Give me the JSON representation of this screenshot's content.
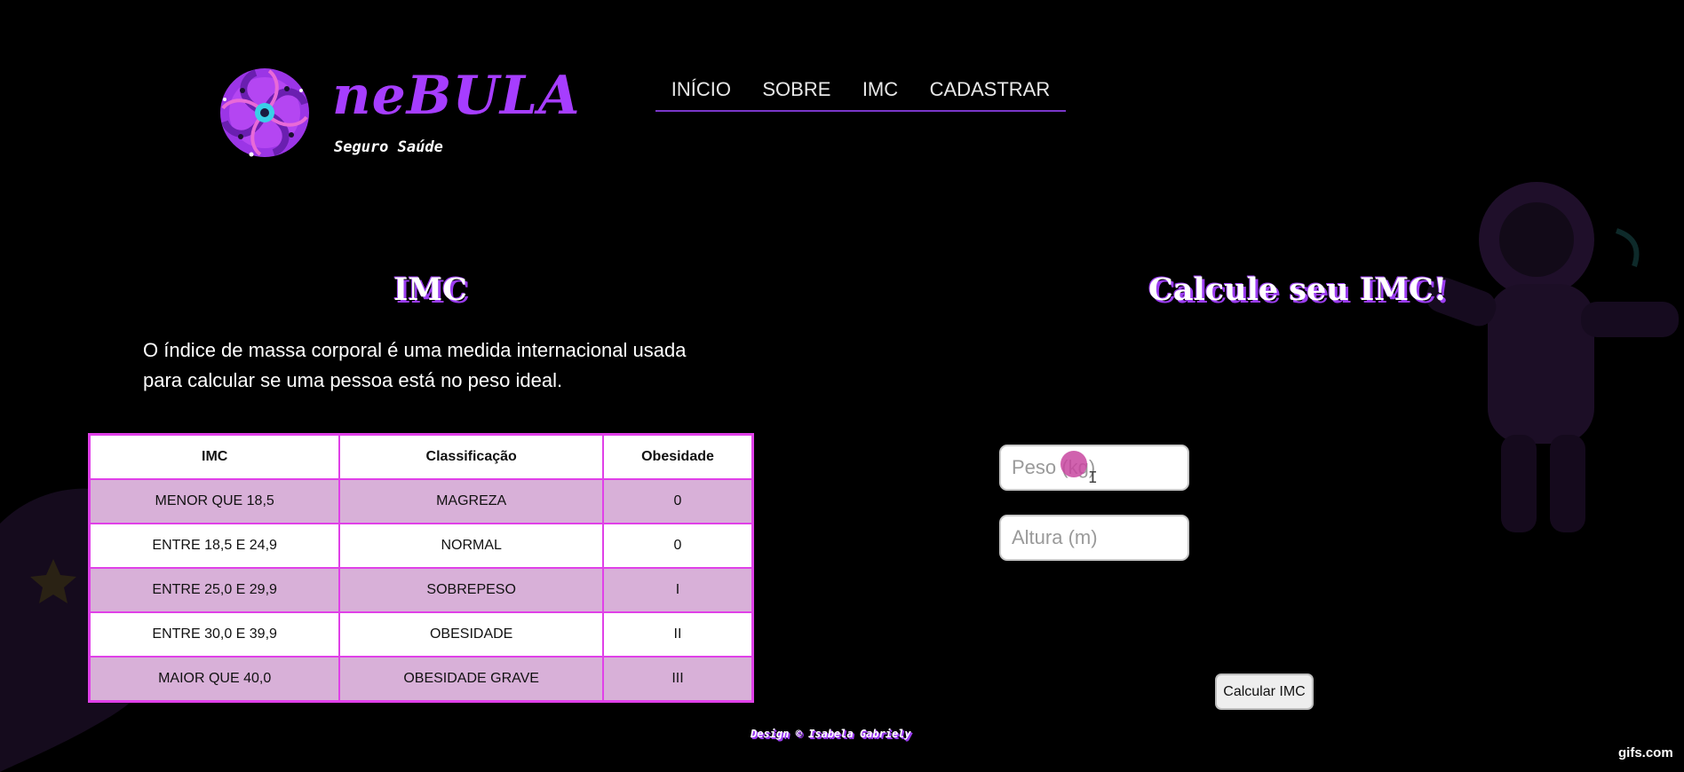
{
  "header": {
    "brand_name": "neBULA",
    "tagline": "Seguro Saúde",
    "logo_icon": "galaxy-logo-icon",
    "nav": [
      {
        "label": "INÍCIO"
      },
      {
        "label": "SOBRE"
      },
      {
        "label": "IMC"
      },
      {
        "label": "CADASTRAR"
      }
    ]
  },
  "imc_section": {
    "title": "IMC",
    "description": "O índice de massa corporal é uma medida internacional usada para calcular se uma pessoa está no peso ideal.",
    "table": {
      "headers": [
        "IMC",
        "Classificação",
        "Obesidade"
      ],
      "rows": [
        [
          "MENOR QUE 18,5",
          "MAGREZA",
          "0"
        ],
        [
          "ENTRE 18,5 E 24,9",
          "NORMAL",
          "0"
        ],
        [
          "ENTRE 25,0 E 29,9",
          "SOBREPESO",
          "I"
        ],
        [
          "ENTRE 30,0 E 39,9",
          "OBESIDADE",
          "II"
        ],
        [
          "MAIOR QUE 40,0",
          "OBESIDADE GRAVE",
          "III"
        ]
      ]
    }
  },
  "calc_section": {
    "title": "Calcule seu IMC!",
    "peso_placeholder": "Peso (kg)",
    "peso_value": "",
    "altura_placeholder": "Altura (m)",
    "altura_value": "",
    "button_label": "Calcular IMC"
  },
  "footer": {
    "credit": "Design © Isabela Gabriely"
  },
  "watermark": "gifs.com",
  "colors": {
    "background": "#000000",
    "brand_purple": "#a63dff",
    "table_border": "#e040e8",
    "table_alt_row": "#d8b0d8",
    "nav_underline": "#7a36c9"
  }
}
